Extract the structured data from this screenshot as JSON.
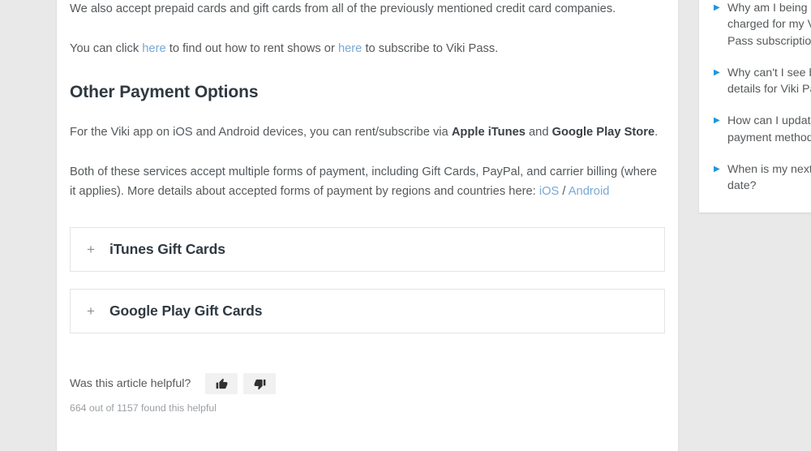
{
  "article": {
    "paragraph_1": "We also accept prepaid cards and gift cards from all of the previously mentioned credit card companies.",
    "paragraph_2": {
      "before_link_1": "You can click ",
      "link_1": "here",
      "between_links": " to find out how to rent shows or ",
      "link_2": "here",
      "after_link_2": " to subscribe to Viki Pass."
    },
    "heading": "Other Payment Options",
    "paragraph_3": {
      "part_1": "For the Viki app on iOS and Android devices, you can rent/subscribe via ",
      "bold_1": "Apple iTunes",
      "part_2": " and ",
      "bold_2": "Google Play Store",
      "part_3": "."
    },
    "paragraph_4": {
      "part_1": "Both of these services accept multiple forms of payment, including Gift Cards, PayPal, and carrier billing (where it applies). More details about accepted forms of payment by regions and countries here: ",
      "link_ios": "iOS",
      "separator": " / ",
      "link_android": "Android"
    },
    "accordions": [
      {
        "icon": "plus-icon",
        "expand_symbol": "+",
        "title": "iTunes Gift Cards"
      },
      {
        "icon": "plus-icon",
        "expand_symbol": "+",
        "title": "Google Play Gift Cards"
      }
    ]
  },
  "feedback": {
    "question": "Was this article helpful?",
    "thumbs_up_icon": "thumbs-up-icon",
    "thumbs_down_icon": "thumbs-down-icon",
    "count_text": "664 out of 1157 found this helpful"
  },
  "sidebar": {
    "arrow_symbol": "▶",
    "items": [
      {
        "label": "Why am I being charged for my Viki Pass subscription?"
      },
      {
        "label": "Why can't I see billing details for Viki Pass?"
      },
      {
        "label": "How can I update my payment method?"
      },
      {
        "label": "When is my next billing date?"
      }
    ]
  },
  "colors": {
    "page_background": "#e9e9e9",
    "card_background": "#ffffff",
    "body_text": "#55595c",
    "heading_text": "#2f3941",
    "link_blue": "#78a9d4",
    "sidebar_arrow_blue": "#2196d6",
    "muted_text": "#9b9fa3",
    "accordion_border": "#e4e4e4",
    "vote_button_background": "#f1f1f1"
  }
}
